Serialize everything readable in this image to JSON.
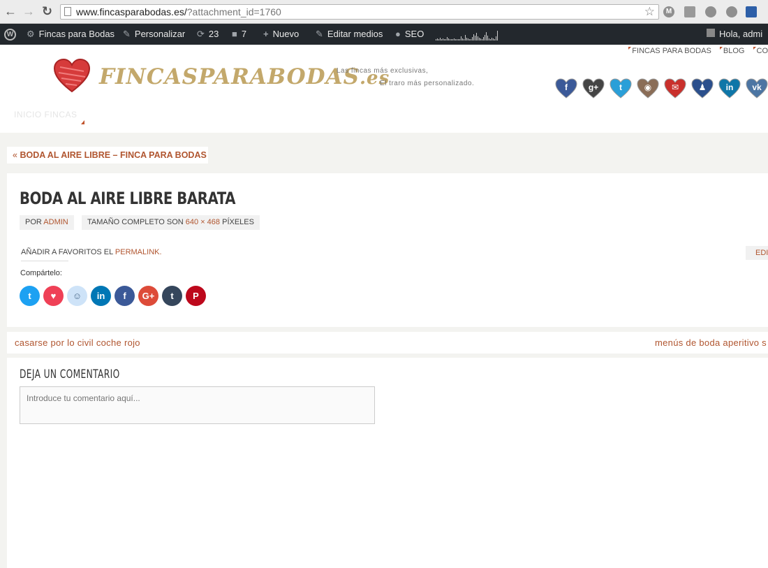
{
  "browser": {
    "url_host": "www.fincasparabodas.es/",
    "url_query": "?attachment_id=1760"
  },
  "adminbar": {
    "site_name": "Fincas para Bodas",
    "customize": "Personalizar",
    "updates_count": "23",
    "comments_count": "7",
    "new_label": "Nuevo",
    "edit_media": "Editar medios",
    "seo": "SEO",
    "greeting": "Hola, admi"
  },
  "header": {
    "top_menu": [
      "FINCAS PARA BODAS",
      "BLOG",
      "CO"
    ],
    "logo_main": "FINCASPARABODAS",
    "logo_tld": ".es",
    "tagline_1": "Las fincas más exclusivas,",
    "tagline_2": "El traro más personalizado.",
    "nav_item": "INICIO FINCAS",
    "social_icons": [
      {
        "name": "facebook-icon",
        "glyph": "f",
        "color": "#3b5998"
      },
      {
        "name": "google-plus-icon",
        "glyph": "g+",
        "color": "#444444"
      },
      {
        "name": "twitter-icon",
        "glyph": "t",
        "color": "#2a9fd8"
      },
      {
        "name": "instagram-icon",
        "glyph": "◉",
        "color": "#8a6d57"
      },
      {
        "name": "email-icon",
        "glyph": "✉",
        "color": "#c9302c"
      },
      {
        "name": "myspace-icon",
        "glyph": "♟",
        "color": "#2b4f8c"
      },
      {
        "name": "linkedin-icon",
        "glyph": "in",
        "color": "#0e76a8"
      },
      {
        "name": "vk-icon",
        "glyph": "vk",
        "color": "#4c75a3"
      }
    ]
  },
  "breadcrumb": {
    "laquo": "«",
    "label": "BODA AL AIRE LIBRE – FINCA PARA BODAS"
  },
  "article": {
    "title": "BODA AL AIRE LIBRE BARATA",
    "by_prefix": "POR",
    "author": "ADMIN",
    "size_prefix": "TAMAÑO COMPLETO SON",
    "size_value": "640 × 468",
    "size_suffix": "PÍXELES",
    "fav_prefix": "AÑADIR A FAVORITOS EL",
    "permalink": "PERMALINK",
    "fav_suffix": ".",
    "edit": "EDI",
    "share_label": "Compártelo:",
    "share_buttons": [
      {
        "name": "share-twitter-button",
        "glyph": "t",
        "color": "#1da1f2"
      },
      {
        "name": "share-pocket-button",
        "glyph": "♥",
        "color": "#ef4056"
      },
      {
        "name": "share-reddit-button",
        "glyph": "☺",
        "color": "#cee3f8"
      },
      {
        "name": "share-linkedin-button",
        "glyph": "in",
        "color": "#0077b5"
      },
      {
        "name": "share-facebook-button",
        "glyph": "f",
        "color": "#3b5998"
      },
      {
        "name": "share-google-button",
        "glyph": "G+",
        "color": "#dd4b39"
      },
      {
        "name": "share-tumblr-button",
        "glyph": "t",
        "color": "#35465c"
      },
      {
        "name": "share-pinterest-button",
        "glyph": "P",
        "color": "#bd081c"
      }
    ]
  },
  "postnav": {
    "prev": "casarse por lo civil coche rojo",
    "next": "menús de boda aperitivo s"
  },
  "comments": {
    "title": "DEJA UN COMENTARIO",
    "placeholder": "Introduce tu comentario aquí..."
  }
}
